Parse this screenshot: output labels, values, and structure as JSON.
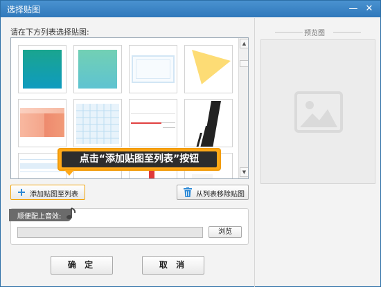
{
  "window": {
    "title": "选择贴图",
    "minimize_glyph": "—",
    "close_glyph": "✕"
  },
  "sticker_list": {
    "label": "请在下方列表选择贴图:",
    "thumbnails": [
      {
        "name": "teal-gradient"
      },
      {
        "name": "mint-gradient"
      },
      {
        "name": "light-blue-frame"
      },
      {
        "name": "yellow-triangle"
      },
      {
        "name": "salmon-gradient"
      },
      {
        "name": "blue-grid"
      },
      {
        "name": "red-line"
      },
      {
        "name": "black-stripes"
      },
      {
        "name": "blue-lines"
      },
      {
        "name": "red-white-partial"
      },
      {
        "name": "black-red-partial"
      },
      {
        "name": "red-partial"
      }
    ],
    "scroll_up": "▲",
    "scroll_down": "▼"
  },
  "callout": {
    "text": "点击“添加贴图至列表”按钮"
  },
  "buttons": {
    "add_label": "添加贴图至列表",
    "remove_label": "从列表移除贴图",
    "browse_label": "浏览",
    "ok_label": "确 定",
    "cancel_label": "取 消"
  },
  "sound": {
    "tag_label": "顺便配上音效:",
    "path_value": ""
  },
  "preview": {
    "title": "预览图"
  },
  "colors": {
    "titlebar": "#3a85c6",
    "callout_border": "#ffa817",
    "callout_bg": "#2d2d2d",
    "accent_blue": "#2e8ad6"
  },
  "icons": {
    "add": "plus-icon",
    "remove": "trash-icon",
    "sound": "music-note-icon",
    "preview_placeholder": "image-icon"
  }
}
